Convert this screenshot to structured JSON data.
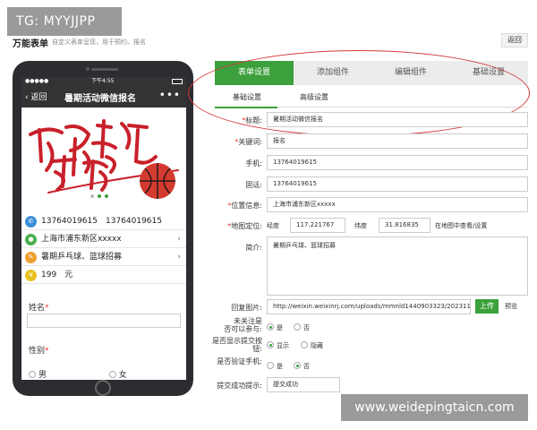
{
  "watermarks": {
    "top_left": "TG: MYYJJPP",
    "bottom_right": "www.weidepingtaicn.com"
  },
  "page": {
    "title": "万能表单",
    "subtitle": "自定义表单呈现，用于预约、报名",
    "back_label": "返回"
  },
  "phone": {
    "status_signal": "●●●●●",
    "status_time": "下午4:55",
    "nav_back": "返回",
    "nav_title": "暑期活动微信报名",
    "nav_more": "•••",
    "rows": [
      {
        "icon": "phone-icon",
        "text": "13764019615　13764019615",
        "color": "#3b8fd9"
      },
      {
        "icon": "location-icon",
        "text": "上海市浦东新区xxxxx",
        "color": "#4caf50"
      },
      {
        "icon": "pencil-icon",
        "text": "暑期乒乓球、篮球招募",
        "color": "#f0a030"
      },
      {
        "icon": "yen-icon",
        "text": "199　元",
        "color": "#e8c020"
      }
    ],
    "name_label": "姓名",
    "gender_label": "性别",
    "gender_options": [
      "男",
      "女"
    ],
    "required_mark": "*"
  },
  "tabs": [
    "表单设置",
    "添加组件",
    "编辑组件",
    "基础设置"
  ],
  "active_tab": 0,
  "subtabs": [
    "基础设置",
    "高级设置"
  ],
  "form": {
    "required_mark": "*",
    "title_label": "标题:",
    "title_value": "暑期活动微信报名",
    "keyword_label": "关键词:",
    "keyword_value": "报名",
    "mobile_label": "手机:",
    "mobile_value": "13764019615",
    "landline_label": "固话:",
    "landline_value": "13764019615",
    "location_label": "位置信息:",
    "location_value": "上海市浦东新区xxxxx",
    "map_label": "地图定位:",
    "longitude_label": "经度",
    "longitude_value": "117.221767",
    "latitude_label": "纬度",
    "latitude_value": "31.816835",
    "map_link": "在地图中查看/设置",
    "intro_label": "简介:",
    "intro_value": "暑期乒乓球、篮球招募",
    "reply_image_label": "回复图片:",
    "reply_image_value": "http://weixin.weixinrj.com/uploads/mmnld1440903323/20231117",
    "upload_label": "上传",
    "preview_label": "预览",
    "q1_label_line1": "未关注是",
    "q1_label_line2": "否可以参与:",
    "q1_options": [
      "是",
      "否"
    ],
    "q2_label_line1": "是否显示提交按",
    "q2_label_line2": "钮:",
    "q2_options": [
      "显示",
      "隐藏"
    ],
    "q3_label": "是否验证手机:",
    "q3_options": [
      "是",
      "否"
    ],
    "success_label": "提交成功提示:",
    "success_value": "提交成功"
  },
  "colors": {
    "accent": "#3ca03c",
    "highlight": "#d23a3a",
    "required": "#e33333"
  }
}
